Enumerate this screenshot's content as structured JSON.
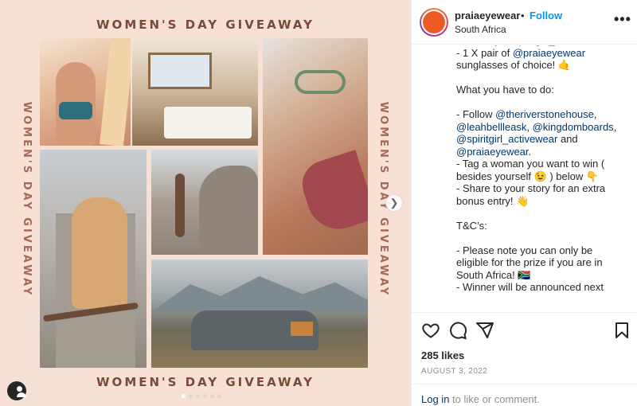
{
  "post": {
    "banner_top": "WOMEN'S DAY GIVEAWAY",
    "banner_bottom": "WOMEN'S DAY GIVEAWAY",
    "side_left": "WOMEN'S DAY GIVEAWAY",
    "side_right": "WOMEN'S DAY GIVEAWAY",
    "carousel": {
      "total_slides": 6,
      "current_slide": 1
    }
  },
  "header": {
    "username": "praiaeyewear",
    "separator": "•",
    "follow_label": "Follow",
    "location": "South Africa",
    "more_icon": "more-horizontal-icon"
  },
  "caption": {
    "lines": [
      {
        "parts": [
          {
            "t": "choice by "
          },
          {
            "m": "@spiritgirl_activewear"
          },
          {
            "t": ".🤙"
          }
        ]
      },
      {
        "parts": [
          {
            "t": "- 1 X pair of "
          },
          {
            "m": "@praiaeyewear"
          }
        ]
      },
      {
        "parts": [
          {
            "t": "sunglasses of choice! 🤙"
          }
        ]
      },
      {
        "gap": true
      },
      {
        "parts": [
          {
            "t": "What you have to do:"
          }
        ]
      },
      {
        "gap": true
      },
      {
        "parts": [
          {
            "t": "- Follow "
          },
          {
            "m": "@theriverstonehouse"
          },
          {
            "t": ","
          }
        ]
      },
      {
        "parts": [
          {
            "m": "@leahbellleask"
          },
          {
            "t": ", "
          },
          {
            "m": "@kingdomboards"
          },
          {
            "t": ","
          }
        ]
      },
      {
        "parts": [
          {
            "m": "@spiritgirl_activewear"
          },
          {
            "t": " and"
          }
        ]
      },
      {
        "parts": [
          {
            "m": "@praiaeyewear"
          },
          {
            "t": "."
          }
        ]
      },
      {
        "parts": [
          {
            "t": "- Tag a woman you want to win ("
          }
        ]
      },
      {
        "parts": [
          {
            "t": "besides yourself 😉 ) below 👇"
          }
        ]
      },
      {
        "parts": [
          {
            "t": "- Share to your story for an extra"
          }
        ]
      },
      {
        "parts": [
          {
            "t": "bonus entry! 👋"
          }
        ]
      },
      {
        "gap": true
      },
      {
        "parts": [
          {
            "t": "T&C’s:"
          }
        ]
      },
      {
        "gap": true
      },
      {
        "parts": [
          {
            "t": "- Please note you can only be"
          }
        ]
      },
      {
        "parts": [
          {
            "t": "eligible for the prize if you are in"
          }
        ]
      },
      {
        "parts": [
          {
            "t": "South Africa! 🇿🇦"
          }
        ]
      },
      {
        "parts": [
          {
            "t": "- Winner will be announced next"
          }
        ]
      }
    ]
  },
  "actions": {
    "like_icon": "heart-icon",
    "comment_icon": "comment-icon",
    "share_icon": "share-icon",
    "save_icon": "bookmark-icon"
  },
  "likes": "285 likes",
  "date": "AUGUST 3, 2022",
  "footer": {
    "login_label": "Log in",
    "login_suffix": " to like or comment."
  }
}
